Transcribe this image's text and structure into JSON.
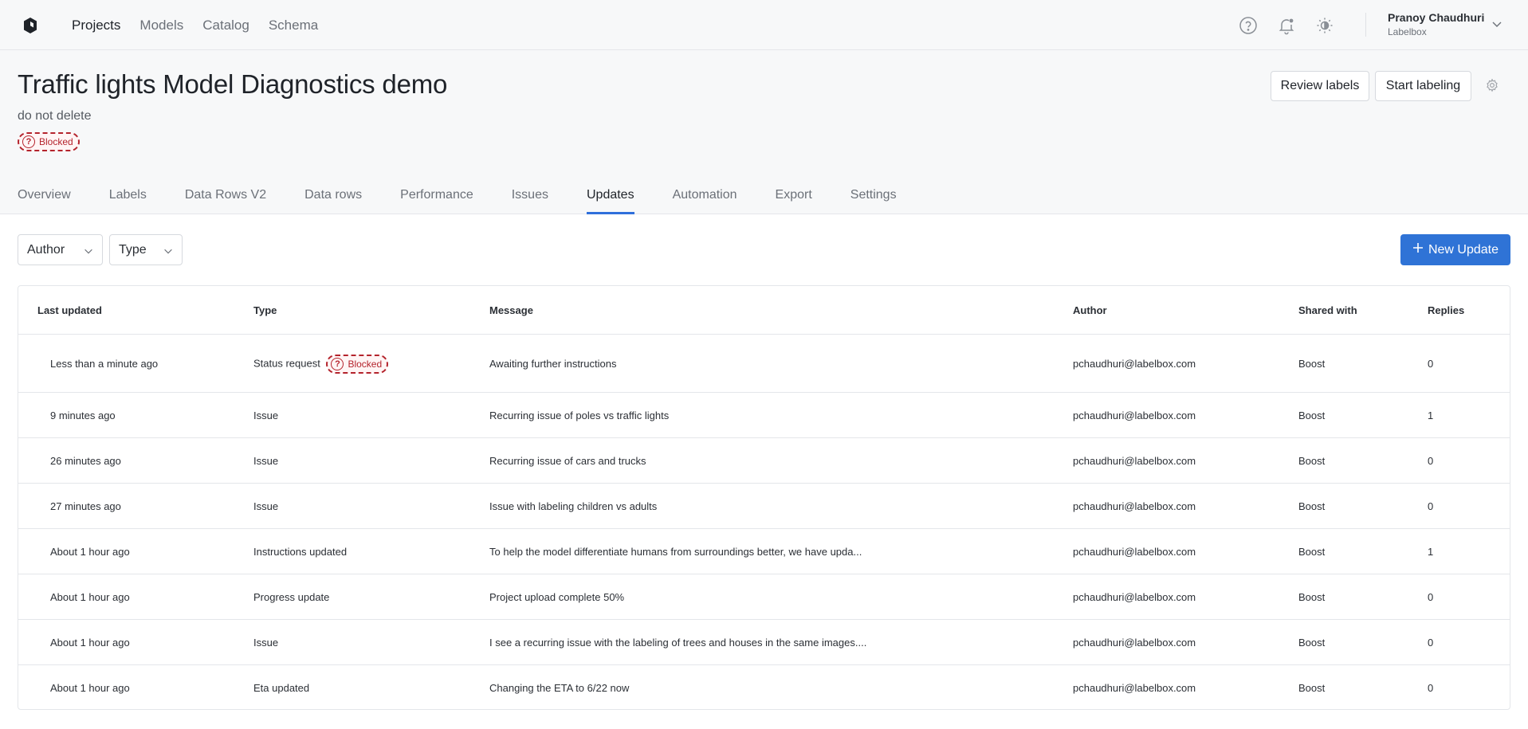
{
  "nav": {
    "items": [
      "Projects",
      "Models",
      "Catalog",
      "Schema"
    ]
  },
  "user": {
    "name": "Pranoy Chaudhuri",
    "org": "Labelbox"
  },
  "project": {
    "title": "Traffic lights Model Diagnostics demo",
    "description": "do not delete",
    "status": "Blocked",
    "review_label": "Review labels",
    "start_label": "Start labeling"
  },
  "tabs": [
    "Overview",
    "Labels",
    "Data Rows V2",
    "Data rows",
    "Performance",
    "Issues",
    "Updates",
    "Automation",
    "Export",
    "Settings"
  ],
  "active_tab": "Updates",
  "filters": {
    "author": "Author",
    "type": "Type"
  },
  "new_update_label": "New Update",
  "table": {
    "columns": [
      "Last updated",
      "Type",
      "Message",
      "Author",
      "Shared with",
      "Replies"
    ],
    "rows": [
      {
        "updated": "Less than a minute ago",
        "type": "Status request",
        "badge": "Blocked",
        "message": "Awaiting further instructions",
        "author": "pchaudhuri@labelbox.com",
        "shared": "Boost",
        "replies": "0"
      },
      {
        "updated": "9 minutes ago",
        "type": "Issue",
        "message": "Recurring issue of poles vs traffic lights",
        "author": "pchaudhuri@labelbox.com",
        "shared": "Boost",
        "replies": "1"
      },
      {
        "updated": "26 minutes ago",
        "type": "Issue",
        "message": "Recurring issue of cars and trucks",
        "author": "pchaudhuri@labelbox.com",
        "shared": "Boost",
        "replies": "0"
      },
      {
        "updated": "27 minutes ago",
        "type": "Issue",
        "message": "Issue with labeling children vs adults",
        "author": "pchaudhuri@labelbox.com",
        "shared": "Boost",
        "replies": "0"
      },
      {
        "updated": "About 1 hour ago",
        "type": "Instructions updated",
        "message": "To help the model differentiate humans from surroundings better, we have upda...",
        "author": "pchaudhuri@labelbox.com",
        "shared": "Boost",
        "replies": "1"
      },
      {
        "updated": "About 1 hour ago",
        "type": "Progress update",
        "message": "Project upload complete 50%",
        "author": "pchaudhuri@labelbox.com",
        "shared": "Boost",
        "replies": "0"
      },
      {
        "updated": "About 1 hour ago",
        "type": "Issue",
        "message": "I see a recurring issue with the labeling of trees and houses in the same images....",
        "author": "pchaudhuri@labelbox.com",
        "shared": "Boost",
        "replies": "0"
      },
      {
        "updated": "About 1 hour ago",
        "type": "Eta updated",
        "message": "Changing the ETA to 6/22 now",
        "author": "pchaudhuri@labelbox.com",
        "shared": "Boost",
        "replies": "0"
      }
    ]
  },
  "icons": {
    "logo": "labelbox-logo-icon",
    "help": "help-icon",
    "notifications": "bell-icon",
    "theme": "theme-toggle-icon",
    "settings": "gear-icon",
    "chevron": "chevron-down-icon",
    "add": "plus-icon"
  },
  "colors": {
    "accent": "#2f73d6",
    "blocked": "#b4232c"
  }
}
